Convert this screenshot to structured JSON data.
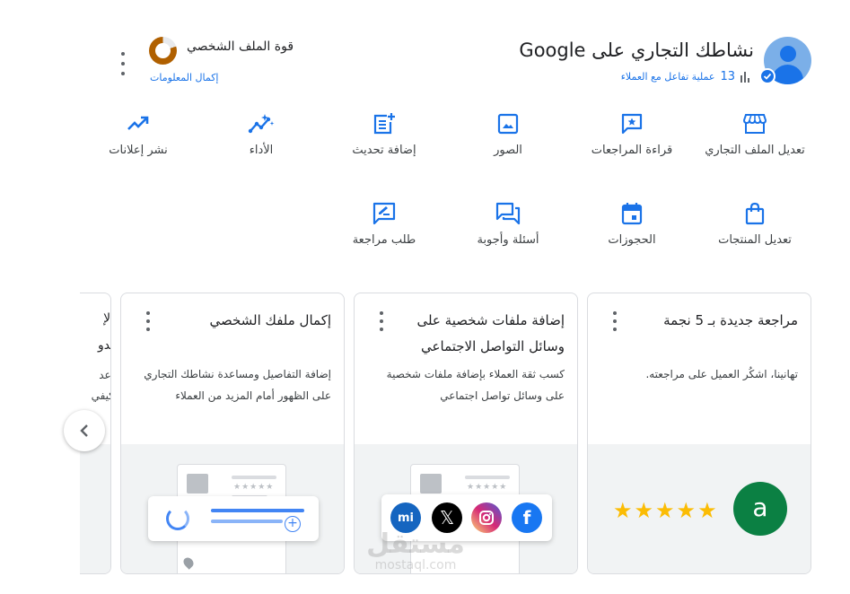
{
  "header": {
    "business_title": "نشاطك التجاري على Google",
    "interactions_count": "13",
    "interactions_label": "عملية تفاعل مع العملاء",
    "profile_strength_title": "قوة الملف الشخصي",
    "complete_info_link": "إكمال المعلومات",
    "profile_strength_fraction": 0.8,
    "accent_color": "#1a73e8"
  },
  "actions_row1": [
    {
      "label": "تعديل الملف التجاري",
      "icon": "storefront-icon"
    },
    {
      "label": "قراءة المراجعات",
      "icon": "review-star-icon"
    },
    {
      "label": "الصور",
      "icon": "image-icon"
    },
    {
      "label": "إضافة تحديث",
      "icon": "post-add-icon"
    },
    {
      "label": "الأداء",
      "icon": "insights-icon"
    },
    {
      "label": "نشر إعلانات",
      "icon": "trending-up-icon"
    }
  ],
  "actions_row2": [
    {
      "label": "تعديل المنتجات",
      "icon": "shopping-bag-icon"
    },
    {
      "label": "الحجوزات",
      "icon": "calendar-icon"
    },
    {
      "label": "أسئلة وأجوبة",
      "icon": "forum-icon"
    },
    {
      "label": "طلب مراجعة",
      "icon": "rate-review-icon"
    }
  ],
  "cards": [
    {
      "title": "مراجعة جديدة بـ 5 نجمة",
      "description": "تهانينا، اشكُر العميل على مراجعته.",
      "stars": "★★★★★",
      "rating": 5,
      "avatar_letter": "a"
    },
    {
      "title": "إضافة ملفات شخصية على وسائل التواصل الاجتماعي",
      "description": "كسب ثقة العملاء بإضافة ملفات شخصية على وسائل تواصل اجتماعي",
      "social_icons": [
        "mi",
        "𝕏",
        "",
        "f"
      ]
    },
    {
      "title": "إكمال ملفك الشخصي",
      "description": "إضافة التفاصيل ومساعدة نشاطك التجاري على الظهور أمام المزيد من العملاء",
      "plus": "+"
    }
  ],
  "partial_card": {
    "title_line1": "الإ",
    "title_line2": "بدو",
    "desc_line1": "إعد",
    "desc_line2": "كيفي"
  },
  "watermark": {
    "line1": "مستقل",
    "line2": "mostaql.com"
  }
}
